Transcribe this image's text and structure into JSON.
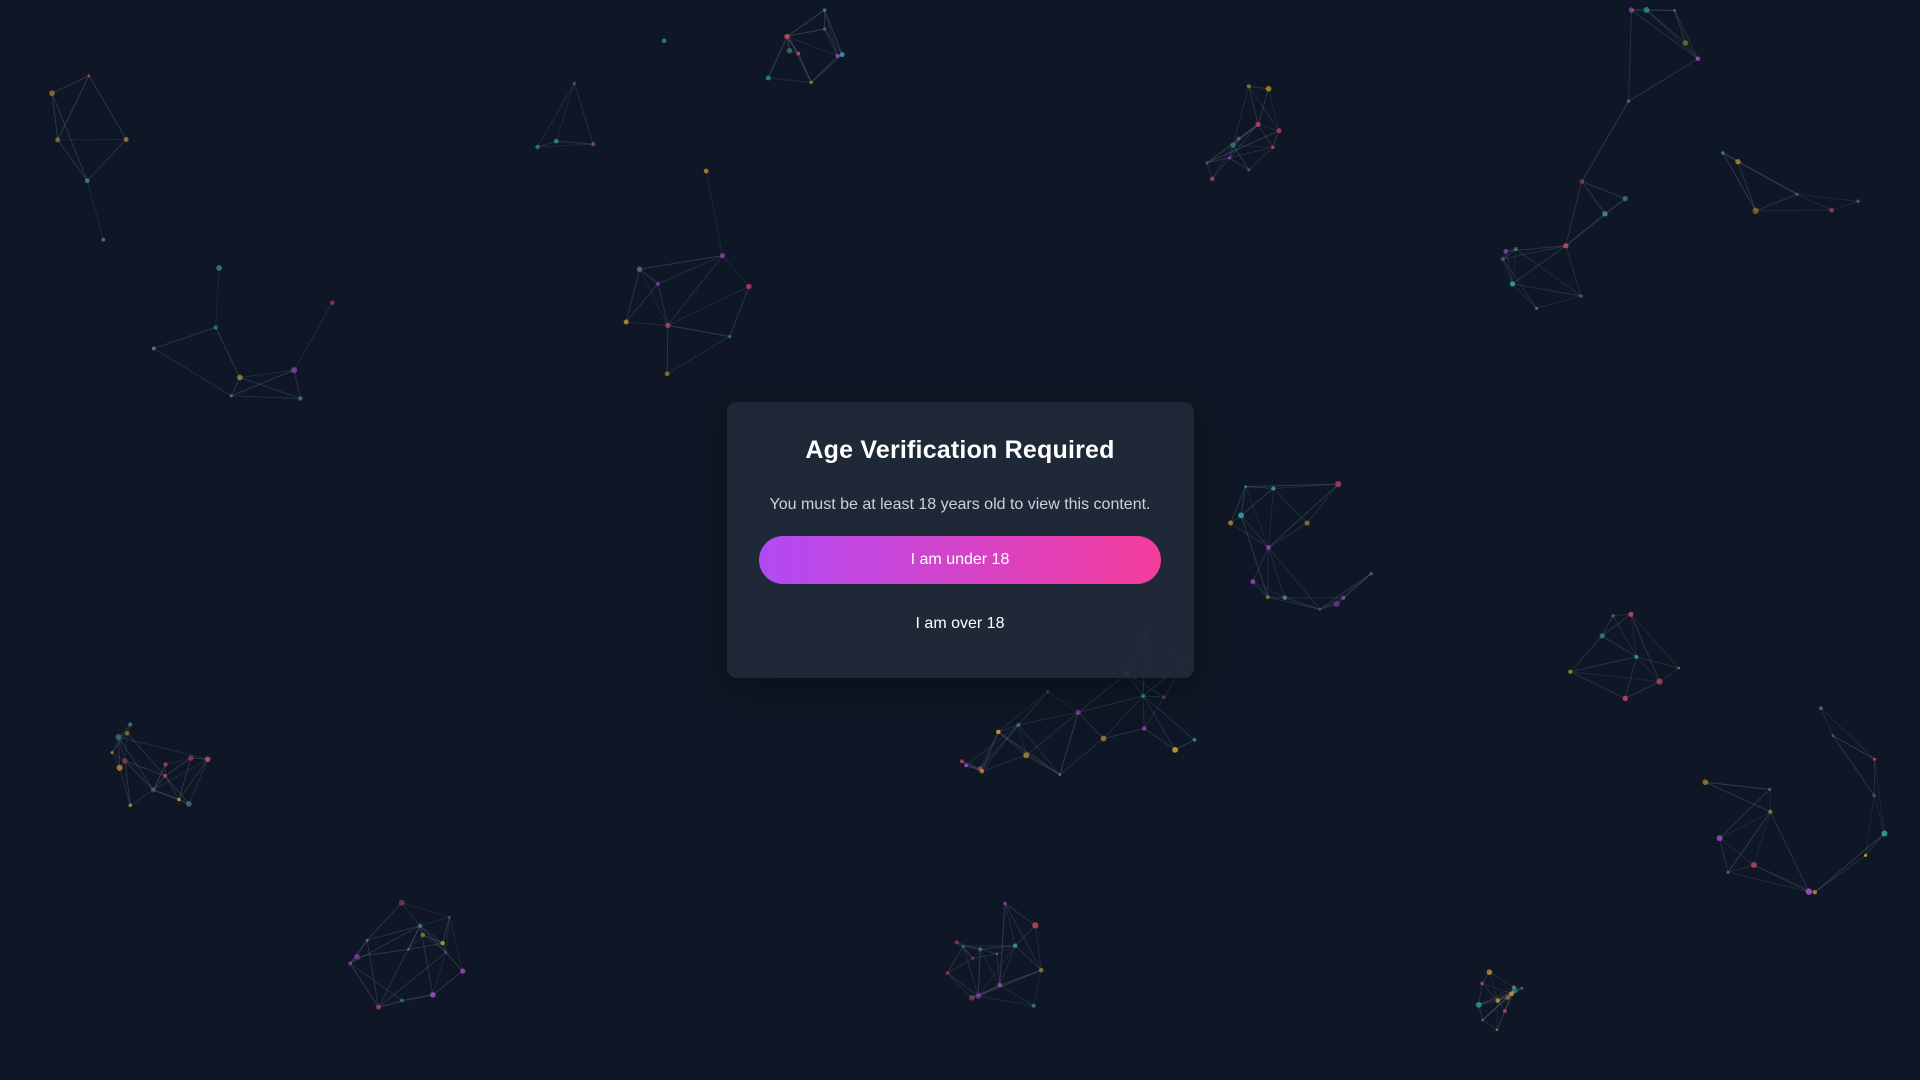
{
  "colors": {
    "background": "#0f1726",
    "modal_background": "#1f2a38",
    "button_gradient_start": "#b14af5",
    "button_gradient_end": "#f53c9c",
    "node_colors": [
      "#2fb8a8",
      "#d9a82a",
      "#b84bd6",
      "#cf4a64",
      "#4d8f8a"
    ]
  },
  "modal": {
    "title": "Age Verification Required",
    "message": "You must be at least 18 years old to view this content.",
    "under_18_label": "I am under 18",
    "over_18_label": "I am over 18"
  }
}
